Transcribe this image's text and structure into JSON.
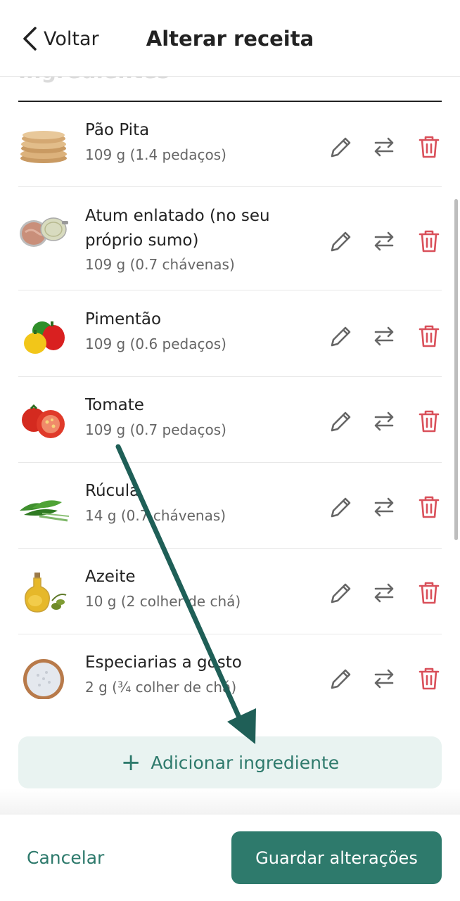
{
  "header": {
    "back_label": "Voltar",
    "title": "Alterar receita"
  },
  "section": {
    "title": "Ingredientes"
  },
  "ingredients": [
    {
      "name": "Pão Pita",
      "qty": "109 g (1.4 pedaços)",
      "image": "pita-bread"
    },
    {
      "name": "Atum enlatado (no seu próprio sumo)",
      "qty": "109 g (0.7 chávenas)",
      "image": "canned-tuna"
    },
    {
      "name": "Pimentão",
      "qty": "109 g (0.6 pedaços)",
      "image": "bell-peppers"
    },
    {
      "name": "Tomate",
      "qty": "109 g (0.7 pedaços)",
      "image": "tomatoes"
    },
    {
      "name": "Rúcula",
      "qty": "14 g (0.7 chávenas)",
      "image": "arugula"
    },
    {
      "name": "Azeite",
      "qty": "10 g (2 colher de chá)",
      "image": "olive-oil"
    },
    {
      "name": "Especiarias a gosto",
      "qty": "2 g (¾ colher de chá)",
      "image": "salt-bowl"
    }
  ],
  "actions": {
    "edit_icon": "pencil-icon",
    "swap_icon": "swap-arrows-icon",
    "delete_icon": "trash-icon"
  },
  "add_button": {
    "label": "Adicionar ingrediente",
    "icon": "plus-icon"
  },
  "footer": {
    "cancel_label": "Cancelar",
    "save_label": "Guardar alterações"
  },
  "colors": {
    "accent": "#2e7a6c",
    "delete": "#d9505a",
    "icon_gray": "#666666",
    "add_bg": "#e9f3f1",
    "annotation_arrow": "#1f5f57"
  }
}
